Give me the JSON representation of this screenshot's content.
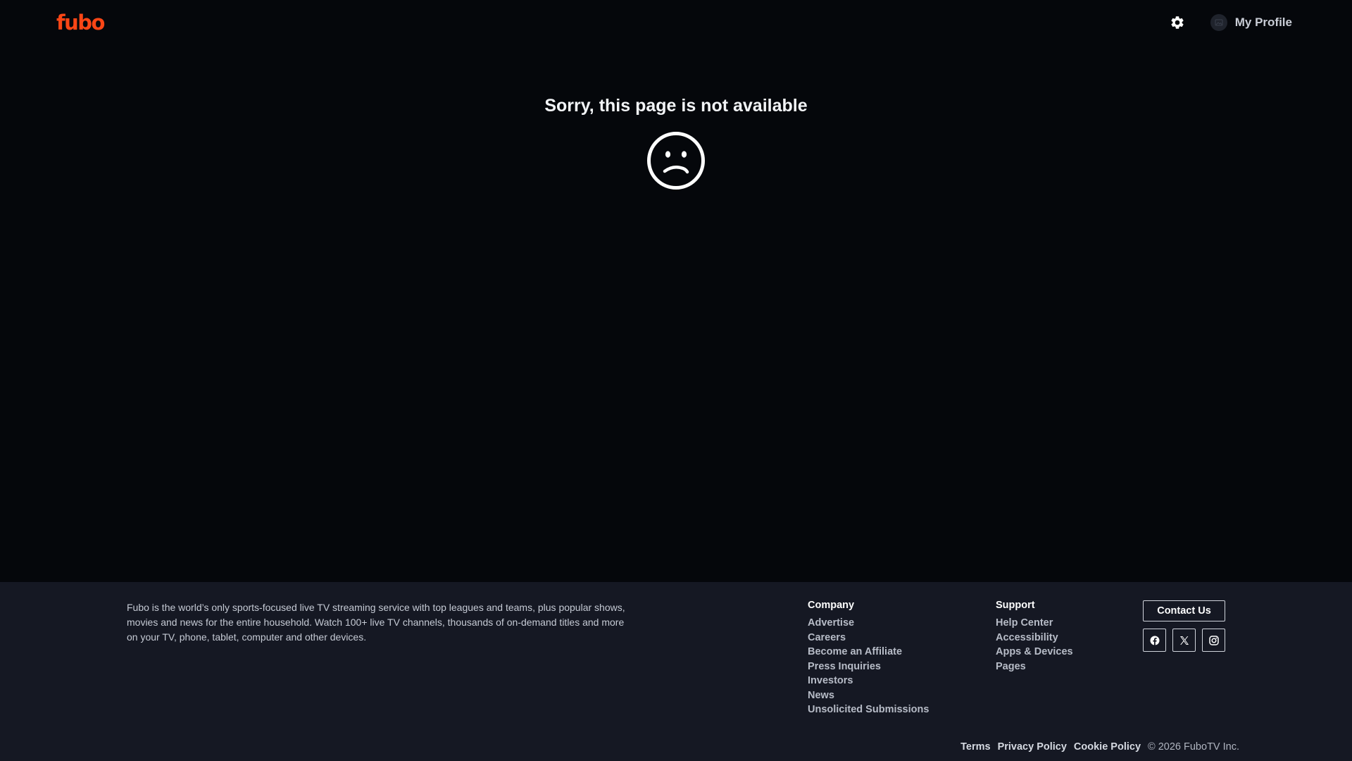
{
  "header": {
    "logo_text": "fubo",
    "brand_color": "#fa4616",
    "settings_icon": "gear-icon",
    "profile_label": "My Profile"
  },
  "main": {
    "error_title": "Sorry, this page is not available",
    "error_icon": "sad-face-icon"
  },
  "footer": {
    "description": "Fubo is the world’s only sports-focused live TV streaming service with top leagues and teams, plus popular shows, movies and news for the entire household. Watch 100+ live TV channels, thousands of on-demand titles and more on your TV, phone, tablet, computer and other devices.",
    "company": {
      "heading": "Company",
      "links": [
        "Advertise",
        "Careers",
        "Become an Affiliate",
        "Press Inquiries",
        "Investors",
        "News",
        "Unsolicited Submissions"
      ]
    },
    "support": {
      "heading": "Support",
      "links": [
        "Help Center",
        "Accessibility",
        "Apps & Devices",
        "Pages"
      ]
    },
    "contact_label": "Contact Us",
    "social": [
      "facebook-icon",
      "x-icon",
      "instagram-icon"
    ],
    "legal": {
      "terms": "Terms",
      "privacy": "Privacy Policy",
      "cookie": "Cookie Policy",
      "copyright": "© 2026 FuboTV Inc."
    }
  }
}
